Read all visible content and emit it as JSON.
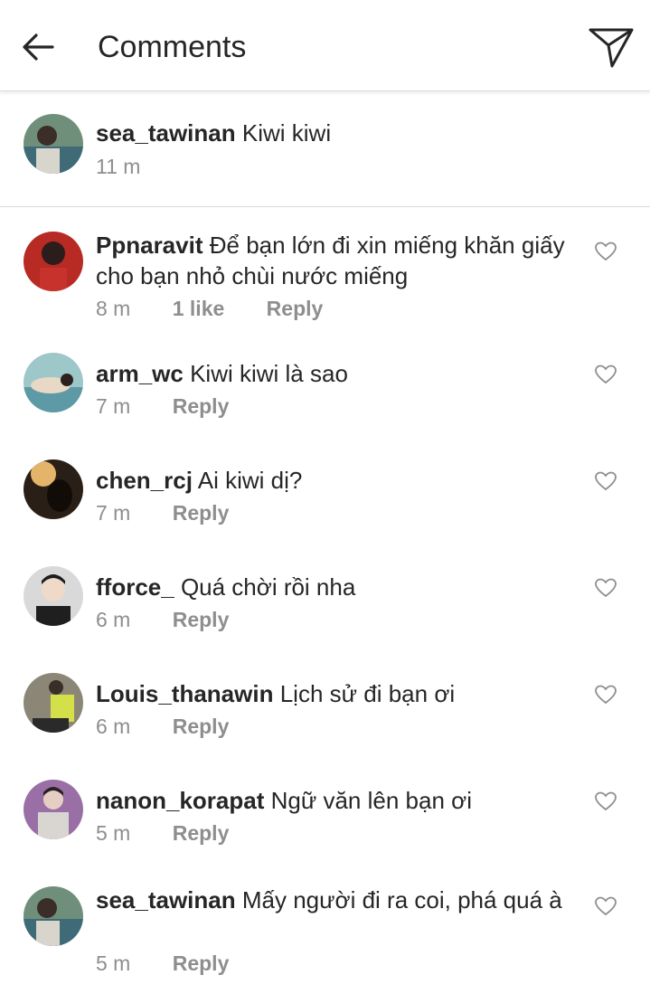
{
  "header": {
    "title": "Comments"
  },
  "caption": {
    "username": "sea_tawinan",
    "text": "Kiwi kiwi",
    "time": "11 m"
  },
  "reply_label": "Reply",
  "comments": [
    {
      "username": "Ppnaravit",
      "text": "Để bạn lớn đi xin miếng khăn giấy cho bạn nhỏ chùi nước miếng",
      "time": "8 m",
      "likes": "1 like"
    },
    {
      "username": "arm_wc",
      "text": "Kiwi kiwi là sao",
      "time": "7 m"
    },
    {
      "username": "chen_rcj",
      "text": "Ai kiwi dị?",
      "time": "7 m"
    },
    {
      "username": "fforce_",
      "text": "Quá chời rồi nha",
      "time": "6 m"
    },
    {
      "username": "Louis_thanawin",
      "text": "Lịch sử đi bạn ơi",
      "time": "6 m"
    },
    {
      "username": "nanon_korapat",
      "text": "Ngữ văn lên bạn ơi",
      "time": "5 m"
    },
    {
      "username": "sea_tawinan",
      "text": "Mấy người đi ra coi, phá quá à",
      "time": "5 m"
    }
  ]
}
